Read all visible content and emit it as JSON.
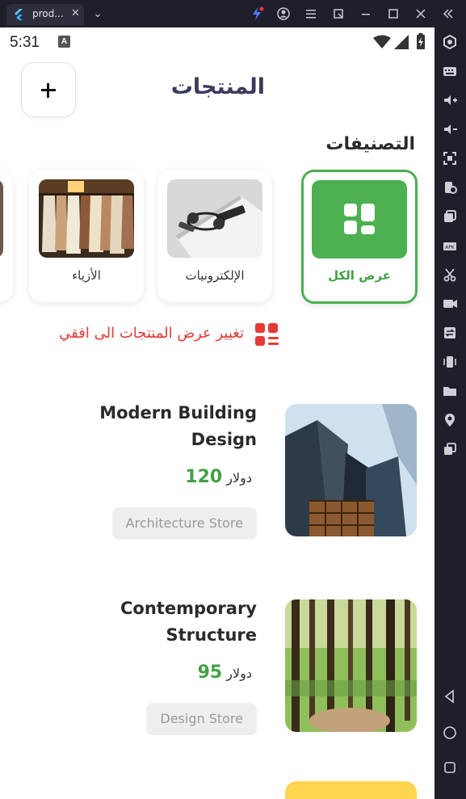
{
  "window": {
    "tab_title": "prod...",
    "tab_close_glyph": "✕",
    "tab_dropdown_glyph": "⌄",
    "controls": [
      "bolt-icon",
      "account-icon",
      "menu-icon",
      "restore-icon",
      "minimize-icon",
      "maximize-icon",
      "close-icon",
      "collapse-icon"
    ]
  },
  "status_bar": {
    "time": "5:31",
    "notification_badge": "A"
  },
  "header": {
    "title": "المنتجات",
    "add_button_icon": "plus-icon"
  },
  "categories": {
    "title": "التصنيفات",
    "items": [
      {
        "label": "عرض الكل",
        "icon": "grid-icon",
        "active": true
      },
      {
        "label": "الإلكترونيات",
        "icon": "electronics-image",
        "active": false
      },
      {
        "label": "الأزياء",
        "icon": "fashion-image",
        "active": false
      }
    ]
  },
  "view_toggle": {
    "text": "تغيير عرض المنتجات الى افقي",
    "icon": "grid-list-icon"
  },
  "products": [
    {
      "name": "Modern Building Design",
      "price": "120",
      "currency": "دولار",
      "store": "Architecture Store",
      "image": "skyscrapers-image"
    },
    {
      "name": "Contemporary Structure",
      "price": "95",
      "currency": "دولار",
      "store": "Design Store",
      "image": "forest-image"
    }
  ],
  "colors": {
    "accent_green": "#4caf50",
    "title_color": "#3b3b5c",
    "toggle_red": "#e53935"
  }
}
